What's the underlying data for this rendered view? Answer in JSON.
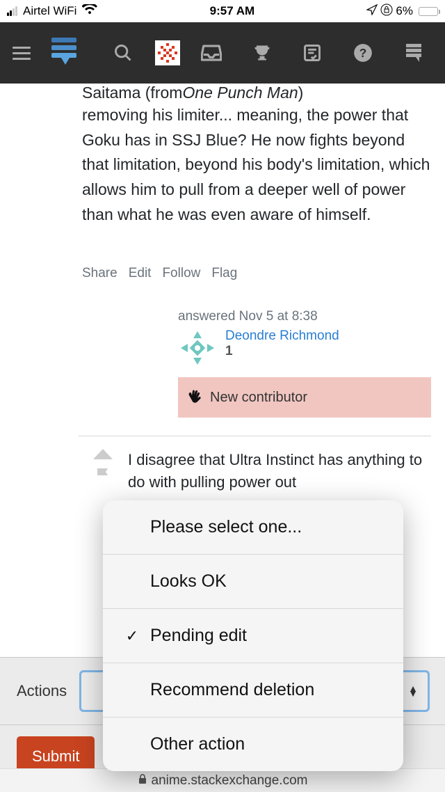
{
  "status": {
    "carrier": "Airtel WiFi",
    "time": "9:57 AM",
    "battery": "6%"
  },
  "post": {
    "prev_plain": "Saitama (from ",
    "prev_ital": "One Punch Man",
    "prev_end": ")",
    "body": "removing his limiter... meaning, the power that Goku has in SSJ Blue? He now fights beyond that limitation, beyond his body's limitation, which allows him to pull from a deeper well of power than what he was even aware of himself."
  },
  "action_links": {
    "share": "Share",
    "edit": "Edit",
    "follow": "Follow",
    "flag": "Flag"
  },
  "usercard": {
    "answered": "answered Nov 5 at 8:38",
    "name": "Deondre Richmond",
    "rep": "1",
    "newc": "New contributor"
  },
  "comment": {
    "text": "I disagree that Ultra Instinct has anything to do with pulling power out"
  },
  "actions": {
    "label": "Actions",
    "submit": "Submit"
  },
  "dropdown": {
    "title": "Please select one...",
    "items": [
      {
        "label": "Looks OK",
        "checked": false
      },
      {
        "label": "Pending edit",
        "checked": true
      },
      {
        "label": "Recommend deletion",
        "checked": false
      },
      {
        "label": "Other action",
        "checked": false
      }
    ]
  },
  "url": "anime.stackexchange.com"
}
